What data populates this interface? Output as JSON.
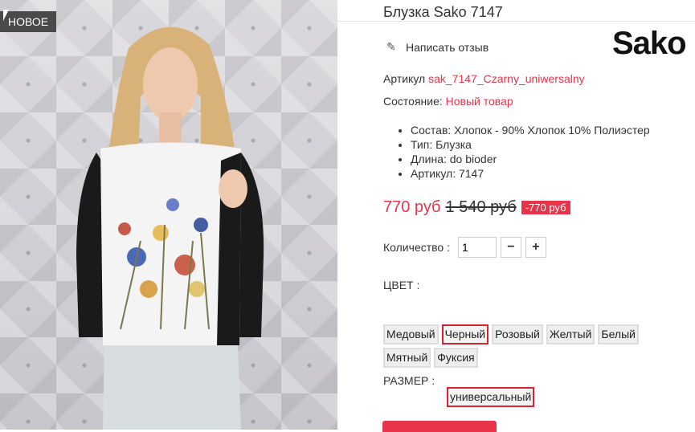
{
  "product": {
    "badge": "НОВОЕ",
    "title": "Блузка Sako 7147",
    "brand_logo": "Sako",
    "review_label": "Написать отзыв",
    "article_label": "Артикул",
    "article_value": "sak_7147_Czarny_uniwersalny",
    "condition_label": "Состояние:",
    "condition_value": "Новый товар",
    "specs": [
      "Состав: Хлопок - 90% Хлопок 10% Полиэстер",
      "Тип: Блузка",
      "Длина: do bioder",
      "Артикул: 7147"
    ],
    "price_now": "770 руб",
    "price_old": "1 540 руб",
    "discount": "-770 руб",
    "qty_label": "Количество :",
    "qty_value": "1",
    "color_label": "ЦВЕТ :",
    "colors": [
      "Медовый",
      "Черный",
      "Розовый",
      "Желтый",
      "Белый",
      "Мятный",
      "Фуксия"
    ],
    "selected_color": "Черный",
    "size_label": "РАЗМЕР :",
    "size_value": "универсальный"
  },
  "icons": {
    "review": "pencil-icon",
    "minus": "minus-icon",
    "plus": "plus-icon"
  },
  "colors_theme": {
    "accent": "#e8334a",
    "selected_border": "#d9232e"
  }
}
